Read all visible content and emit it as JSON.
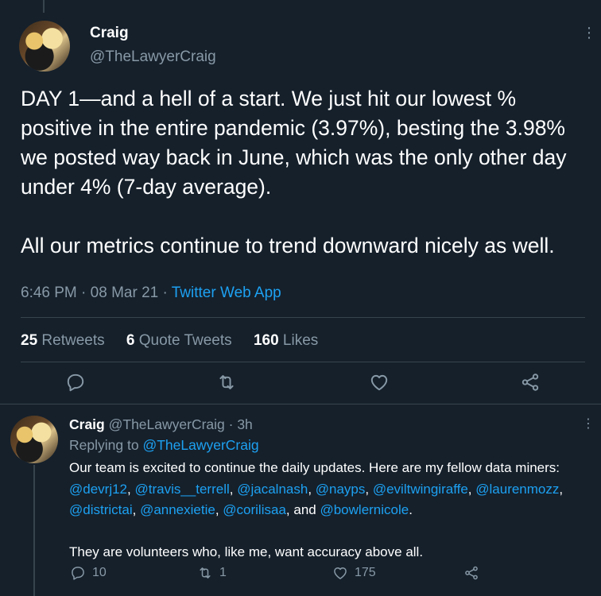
{
  "colors": {
    "background": "#15202b",
    "muted": "#8899a6",
    "link": "#1da1f2",
    "divider": "#38444d"
  },
  "main_tweet": {
    "author_name": "Craig",
    "handle": "@TheLawyerCraig",
    "more_icon": "more-vertical-icon",
    "text": "DAY 1—and a hell of a start. We just hit our lowest % positive in the entire pandemic (3.97%), besting the 3.98% we posted way back in June, which was the only other day under 4% (7-day average).\n\nAll our metrics continue to trend downward nicely as well.",
    "time": "6:46 PM",
    "date": "08 Mar 21",
    "source": "Twitter Web App",
    "retweets_count": "25",
    "retweets_label": "Retweets",
    "quotes_count": "6",
    "quotes_label": "Quote Tweets",
    "likes_count": "160",
    "likes_label": "Likes",
    "action_icons": [
      "reply-icon",
      "retweet-icon",
      "like-icon",
      "share-icon"
    ]
  },
  "reply": {
    "author_name": "Craig",
    "handle": "@TheLawyerCraig",
    "age": "3h",
    "replying_prefix": "Replying to",
    "replying_handle": "@TheLawyerCraig",
    "text_intro": "Our team is excited to continue the daily updates. Here are my fellow data miners:",
    "mentions": [
      "@devrj12",
      "@travis__terrell",
      "@jacalnash",
      "@nayps",
      "@eviltwingiraffe",
      "@laurenmozz",
      "@districtai",
      "@annexietie",
      "@corilisaa",
      "@bowlernicole"
    ],
    "and_word": "and",
    "text_outro": "They are volunteers who, like me, want accuracy above all.",
    "reply_count": "10",
    "retweet_count": "1",
    "like_count": "175"
  }
}
